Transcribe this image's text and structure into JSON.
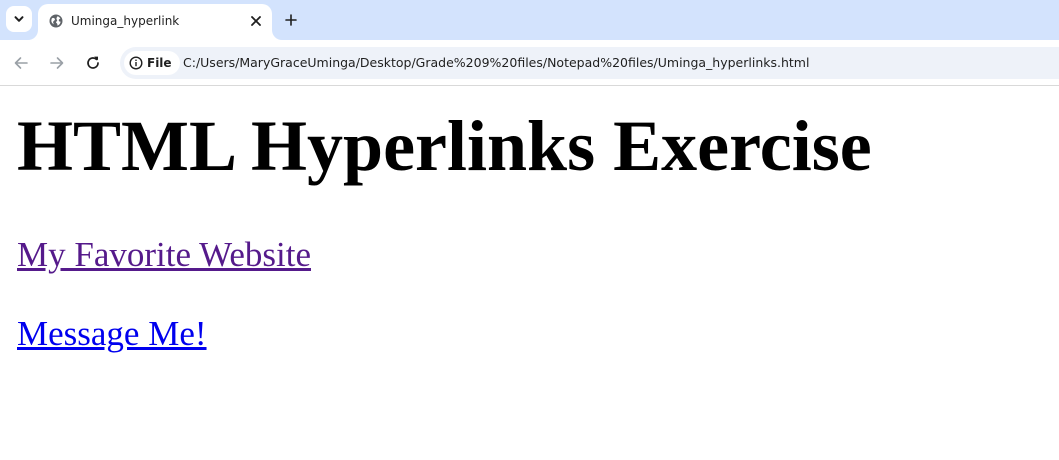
{
  "browser": {
    "tab": {
      "title": "Uminga_hyperlink"
    },
    "address_bar": {
      "site_chip_label": "File",
      "url": "C:/Users/MaryGraceUminga/Desktop/Grade%209%20files/Notepad%20files/Uminga_hyperlinks.html"
    },
    "icons": {
      "tab_search": "chevron-down-icon",
      "favicon": "globe-icon",
      "close_tab": "close-icon",
      "new_tab": "plus-icon",
      "back": "arrow-left-icon",
      "forward": "arrow-right-icon",
      "reload": "reload-icon",
      "site_info": "info-icon"
    },
    "colors": {
      "tabstrip_bg": "#d3e3fd",
      "omnibox_bg": "#eef2f9"
    }
  },
  "page": {
    "heading": "HTML Hyperlinks Exercise",
    "links": [
      {
        "label": "My Favorite Website",
        "state": "visited",
        "color": "#551a8b"
      },
      {
        "label": "Message Me!",
        "state": "unvisited",
        "color": "#0000ee"
      }
    ]
  }
}
